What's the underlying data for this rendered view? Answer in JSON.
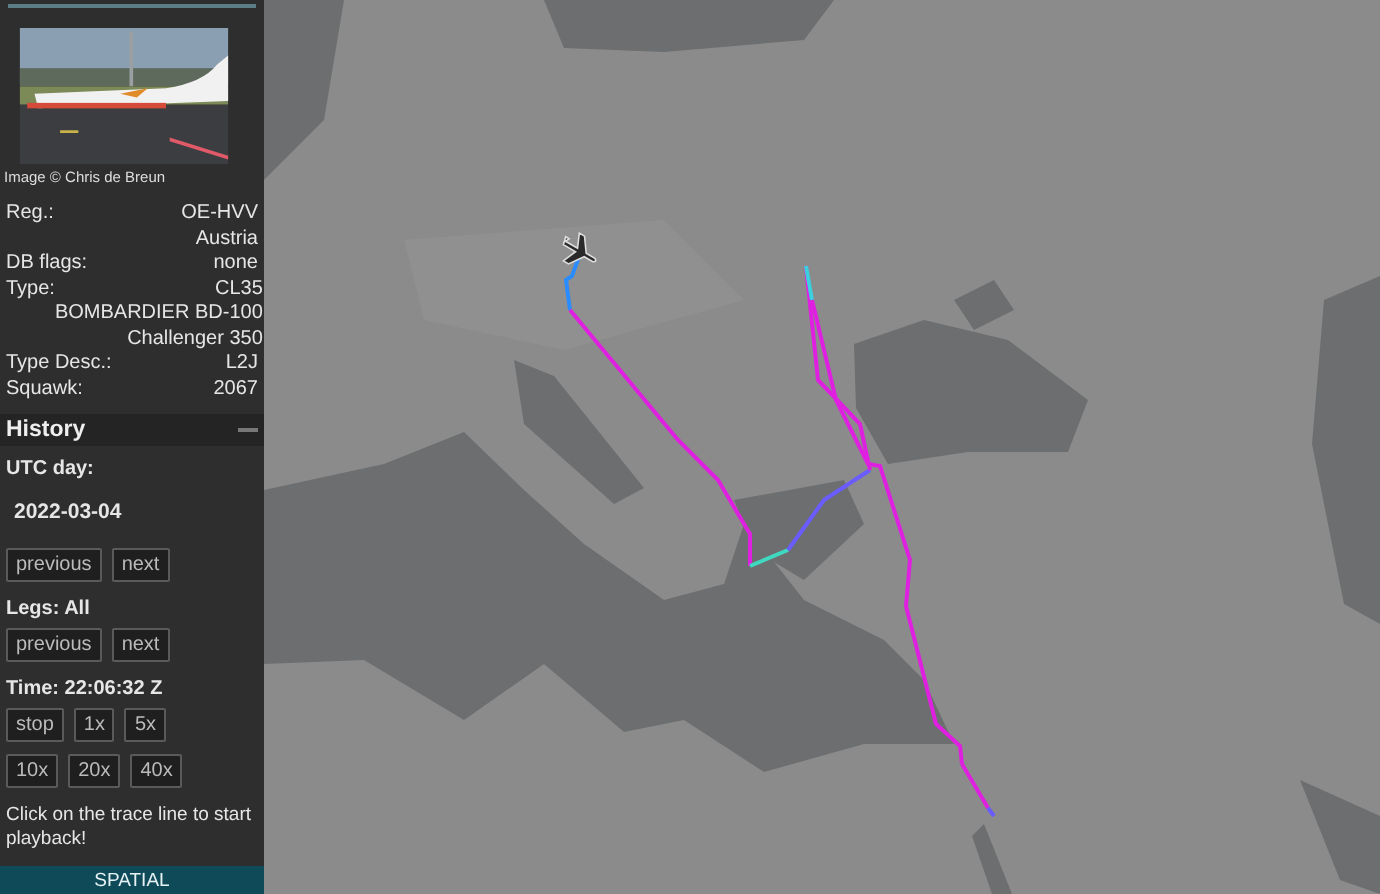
{
  "photo": {
    "kind": "picture",
    "credit": "Image © Chris de Breun"
  },
  "details": [
    {
      "label": "Reg.:",
      "values": [
        "OE-HVV",
        "Austria"
      ]
    },
    {
      "label": "DB flags:",
      "values": [
        "none"
      ]
    },
    {
      "label": "Type:",
      "values": [
        "CL35",
        "BOMBARDIER BD-100",
        "Challenger 350"
      ]
    },
    {
      "label": "Type Desc.:",
      "values": [
        "L2J"
      ]
    },
    {
      "label": "Squawk:",
      "values": [
        "2067"
      ]
    }
  ],
  "history": {
    "title": "History",
    "expanded": true,
    "day_label": "UTC day:",
    "day": "2022-03-04",
    "day_buttons": [
      "previous",
      "next"
    ],
    "legs_label": "Legs: All",
    "legs_buttons": [
      "previous",
      "next"
    ],
    "time_label": "Time: 22:06:32 Z",
    "speed_rows": [
      [
        "stop",
        "1x",
        "5x"
      ],
      [
        "10x",
        "20x",
        "40x"
      ]
    ],
    "note": "Click on the trace line to start playback!"
  },
  "footer": {
    "label": "SPATIAL"
  }
}
